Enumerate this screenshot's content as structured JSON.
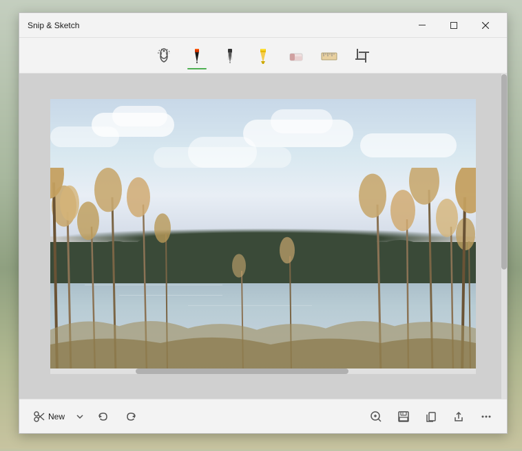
{
  "app": {
    "title": "Snip & Sketch"
  },
  "titlebar": {
    "minimize_label": "─",
    "maximize_label": "□",
    "close_label": "✕"
  },
  "toolbar": {
    "tools": [
      {
        "id": "touch",
        "label": "Touch writing",
        "icon": "touch"
      },
      {
        "id": "ballpoint",
        "label": "Ballpoint pen",
        "icon": "ballpoint",
        "active": true
      },
      {
        "id": "pencil",
        "label": "Pencil",
        "icon": "pencil"
      },
      {
        "id": "highlighter",
        "label": "Highlighter",
        "icon": "highlighter"
      },
      {
        "id": "eraser",
        "label": "Eraser",
        "icon": "eraser"
      },
      {
        "id": "ruler",
        "label": "Ruler",
        "icon": "ruler"
      },
      {
        "id": "crop",
        "label": "Crop",
        "icon": "crop"
      }
    ]
  },
  "bottombar": {
    "new_label": "New",
    "new_dropdown_label": "New options",
    "undo_label": "Undo",
    "redo_label": "Redo",
    "zoom_in_label": "Zoom in",
    "save_label": "Save",
    "copy_label": "Copy",
    "share_label": "Share",
    "more_label": "More options"
  },
  "colors": {
    "active_tool_indicator": "#4caf50",
    "ballpoint_color": "#1a1a1a",
    "highlighter_color": "#f4c430"
  }
}
